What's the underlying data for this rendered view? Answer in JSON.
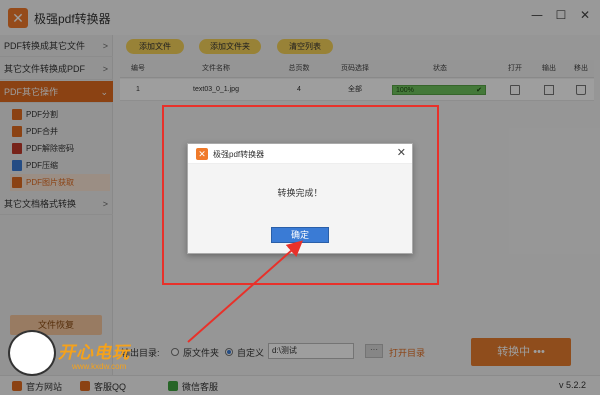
{
  "app": {
    "title": "极强pdf转换器"
  },
  "window_controls": {
    "minimize": "—",
    "maximize": "☐",
    "close": "✕"
  },
  "sidebar": {
    "items": [
      {
        "label": "PDF转换成其它文件",
        "arrow": ">"
      },
      {
        "label": "其它文件转换成PDF",
        "arrow": ">"
      },
      {
        "label": "PDF其它操作",
        "arrow": "⌄"
      },
      {
        "label": "其它文档格式转换",
        "arrow": ">"
      }
    ],
    "sub_items": [
      {
        "label": "PDF分割",
        "icon_color": "#e06b1f"
      },
      {
        "label": "PDF合并",
        "icon_color": "#e06b1f"
      },
      {
        "label": "PDF解除密码",
        "icon_color": "#c0392b"
      },
      {
        "label": "PDF压缩",
        "icon_color": "#3a7bd5"
      },
      {
        "label": "PDF图片获取",
        "icon_color": "#e06b1f"
      }
    ],
    "recover": "文件恢复"
  },
  "toolbar": {
    "add_file": "添加文件",
    "add_folder": "添加文件夹",
    "clear_list": "清空列表"
  },
  "table": {
    "headers": [
      "编号",
      "文件名称",
      "总页数",
      "页码选择",
      "状态",
      "打开",
      "输出",
      "移出"
    ],
    "rows": [
      {
        "index": "1",
        "name": "text03_0_1.jpg",
        "pages": "4",
        "range": "全部",
        "status": "100%",
        "status_check": "✔"
      }
    ]
  },
  "output": {
    "label": "输出目录:",
    "option_original": "原文件夹",
    "option_custom": "自定义",
    "path": "d:\\测试",
    "browse": "···",
    "open_dir": "打开目录"
  },
  "convert_button": "转换中 •••",
  "statusbar": {
    "website": "官方网站",
    "qq": "客服QQ",
    "wechat": "微信客服",
    "version": "v 5.2.2"
  },
  "dialog": {
    "title": "极强pdf转换器",
    "close": "✕",
    "message": "转换完成！",
    "ok": "确定"
  },
  "watermark": {
    "text": "开心电玩",
    "sub": "www.kxdw.com"
  },
  "colors": {
    "accent": "#e06b1f",
    "highlight": "#e8312a",
    "ok_button": "#3a7bd5",
    "progress": "#6fc35d",
    "toolbar_button": "#f5d25a"
  }
}
